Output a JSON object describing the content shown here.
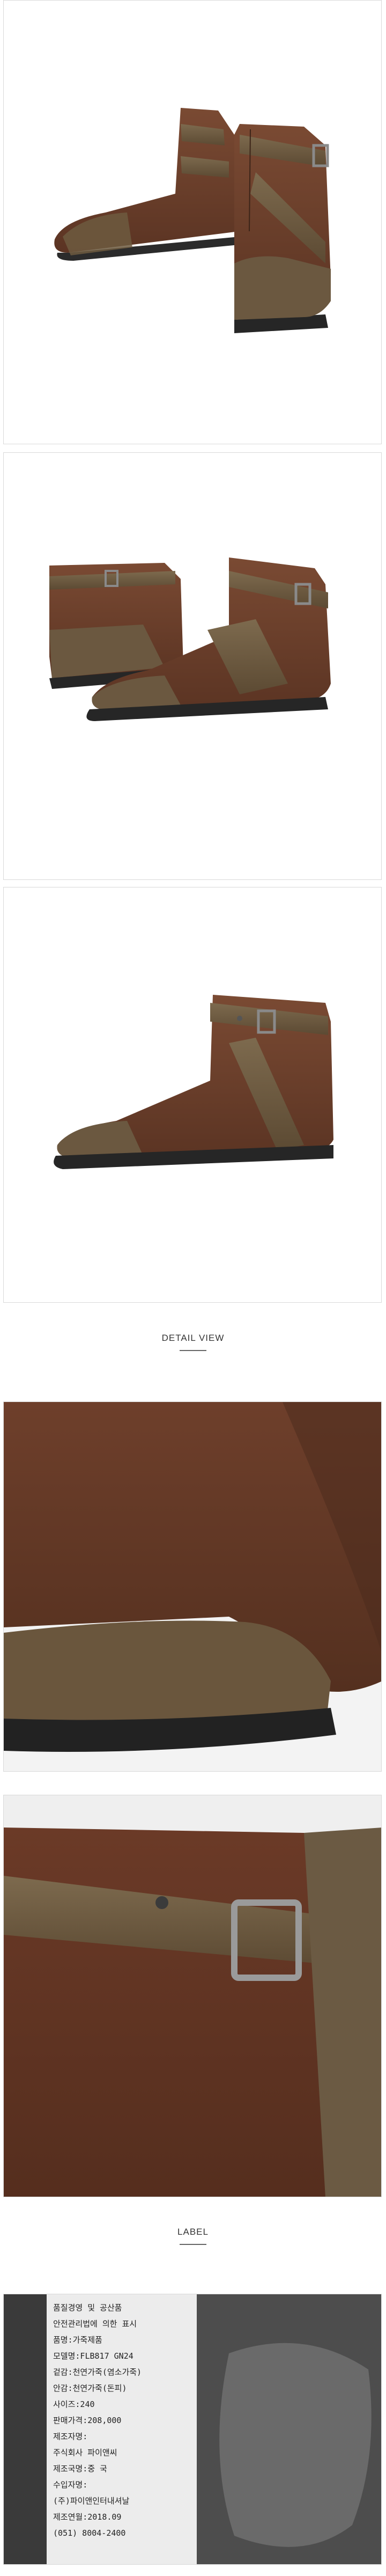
{
  "sections": {
    "detail_view": "DETAIL VIEW",
    "label": "LABEL"
  },
  "label_tag": {
    "lines": [
      "품질경영 및 공산품",
      "안전관리법에 의한 표시",
      "품명:가죽제품",
      "모델명:FLB817 GN24",
      "겉감:천연가죽(염소가죽)",
      "안감:천연가죽(돈피)",
      "사이즈:240",
      "판매가격:208,000",
      "제조자명:",
      "주식회사 파이앤씨",
      "제조국명:중 국",
      "수입자명:",
      "(주)파이앤인터내셔날",
      "제조연월:2018.09",
      "(051) 8004-2400"
    ]
  },
  "colors": {
    "leather": "#6b3f2c",
    "trim": "#6e5a40",
    "sole": "#2a2a2a",
    "buckle": "#8a8a8a"
  }
}
